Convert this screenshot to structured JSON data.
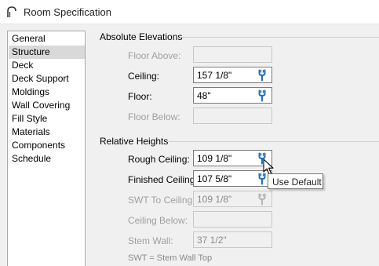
{
  "window": {
    "title": "Room Specification",
    "icon": "arch-icon"
  },
  "nav": {
    "selected_index": 1,
    "items": [
      "General",
      "Structure",
      "Deck",
      "Deck Support",
      "Moldings",
      "Wall Covering",
      "Fill Style",
      "Materials",
      "Components",
      "Schedule"
    ]
  },
  "absolute": {
    "title": "Absolute Elevations",
    "floor_above": {
      "label": "Floor Above:",
      "value": ""
    },
    "ceiling": {
      "label": "Ceiling:",
      "value": "157 1/8\""
    },
    "floor": {
      "label": "Floor:",
      "value": "48\""
    },
    "floor_below": {
      "label": "Floor Below:",
      "value": ""
    }
  },
  "relative": {
    "title": "Relative Heights",
    "rough_ceiling": {
      "label": "Rough Ceiling:",
      "value": "109 1/8\""
    },
    "finished_ceiling": {
      "label": "Finished Ceiling:",
      "value": "107 5/8\""
    },
    "swt_to_ceiling": {
      "label": "SWT To Ceiling:",
      "value": "109 1/8\""
    },
    "ceiling_below": {
      "label": "Ceiling Below:",
      "value": ""
    },
    "stem_wall": {
      "label": "Stem Wall:",
      "value": "37 1/2\""
    },
    "footnote": "SWT = Stem Wall Top"
  },
  "tooltip": {
    "text": "Use Default"
  },
  "colors": {
    "selected_nav_bg": "#d9d9d9",
    "wrench_blue": "#1e6fb8",
    "disabled_text": "#a0a0a0"
  }
}
